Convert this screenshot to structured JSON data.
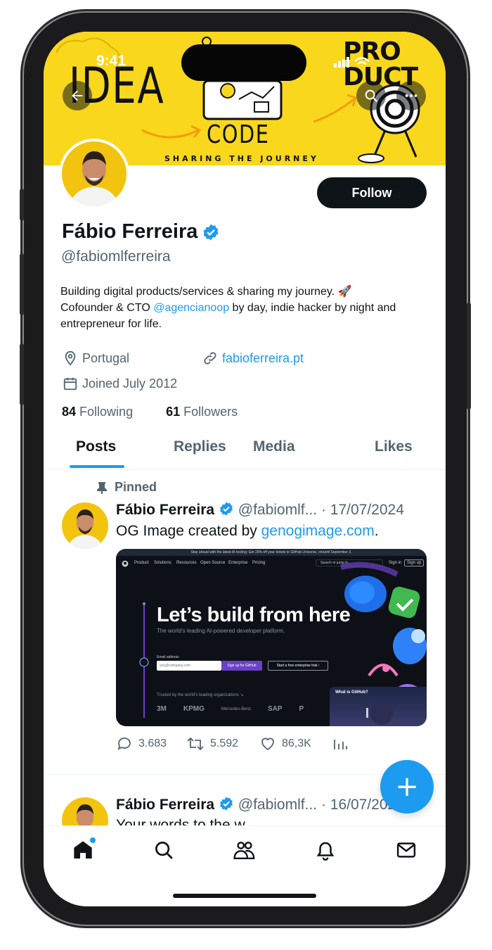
{
  "status_bar": {
    "time": "9:41"
  },
  "banner": {
    "idea": "IDEA",
    "code": "CODE",
    "product_line1": "PRO",
    "product_line2": "DUCT",
    "tagline": "SHARING THE JOURNEY",
    "color": "#f9d71c"
  },
  "header": {
    "back_icon": "arrow-left-icon",
    "search_icon": "search-icon",
    "more_icon": "more-icon"
  },
  "profile": {
    "follow_label": "Follow",
    "name": "Fábio Ferreira",
    "handle": "@fabiomlferreira",
    "bio_line1": "Building digital products/services & sharing my journey. 🚀",
    "bio_line2_pre": "Cofounder & CTO ",
    "bio_mention": "@agencianoop",
    "bio_line2_post": " by day, indie hacker by night and",
    "bio_line3": "entrepreneur for life.",
    "location": "Portugal",
    "website": "fabioferreira.pt",
    "joined": "Joined July 2012",
    "following_count": "84",
    "following_label": "Following",
    "followers_count": "61",
    "followers_label": "Followers"
  },
  "tabs": [
    {
      "label": "Posts",
      "active": true
    },
    {
      "label": "Replies",
      "active": false
    },
    {
      "label": "Media",
      "active": false
    },
    {
      "label": "Likes",
      "active": false
    }
  ],
  "posts": [
    {
      "pinned_label": "Pinned",
      "name": "Fábio Ferreira",
      "handle": "@fabiomlf...",
      "separator": "·",
      "date": "17/07/2024",
      "text_pre": "OG Image created by ",
      "text_link": "genogimage.com",
      "text_post": ".",
      "media": {
        "top_banner": "Stay ahead with the latest AI tooling: Get 20% off your tickets to GitHub Universe, on/until September 3.",
        "nav_items": [
          "Product",
          "Solutions",
          "Resources",
          "Open Source",
          "Enterprise",
          "Pricing"
        ],
        "search_placeholder": "Search or jump to...",
        "sign_in": "Sign in",
        "sign_up": "Sign up",
        "headline": "Let’s build from here",
        "subheadline": "The world’s leading AI-powered developer platform.",
        "email_label": "Email address",
        "email_placeholder": "you@company.com",
        "signup_button": "Sign up for GitHub",
        "trial_button": "Start a free enterprise trial ›",
        "trusted_text": "Trusted by the world’s leading organizations ↘",
        "logos": [
          "3M",
          "KPMG",
          "Mercedes-Benz",
          "SAP",
          "P"
        ],
        "popup_title": "What is GitHub?"
      },
      "replies": "3.683",
      "reposts": "5.592",
      "likes": "86,3K"
    },
    {
      "name": "Fábio Ferreira",
      "handle": "@fabiomlf...",
      "separator": "·",
      "date": "16/07/2024",
      "text": "Your words to the w..."
    }
  ],
  "fab": {
    "label": "+"
  },
  "bottom_nav": [
    "home-icon",
    "search-icon",
    "communities-icon",
    "notifications-icon",
    "messages-icon"
  ],
  "colors": {
    "accent": "#1d9bf0",
    "text": "#0f1419",
    "secondary": "#536471"
  }
}
